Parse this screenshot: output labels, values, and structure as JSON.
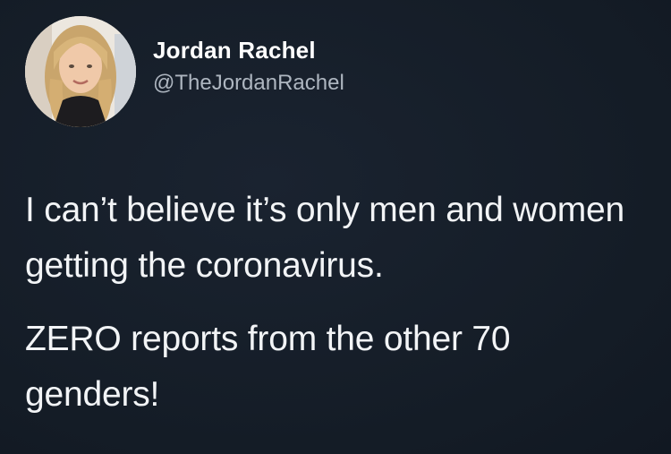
{
  "tweet": {
    "author": {
      "display_name": "Jordan Rachel",
      "handle": "@TheJordanRachel"
    },
    "body": {
      "paragraph_1": "I can’t believe it’s only men and women getting the coronavirus.",
      "paragraph_2": "ZERO reports from the other 70 genders!"
    }
  },
  "colors": {
    "background": "#151d28",
    "text_primary": "#ffffff",
    "text_secondary": "#aeb6c0"
  }
}
